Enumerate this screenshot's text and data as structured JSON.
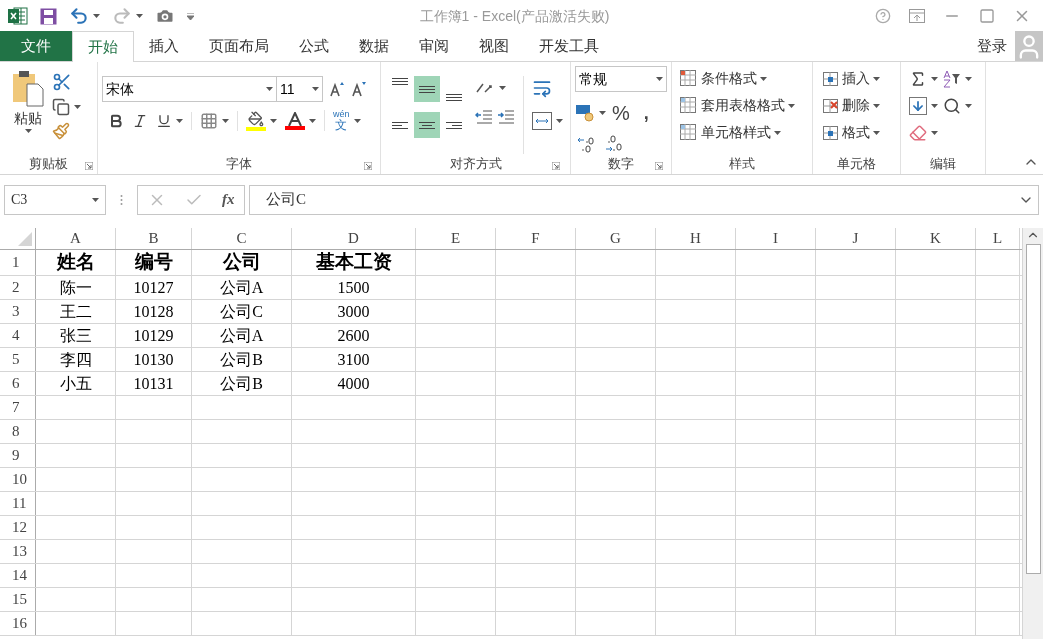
{
  "window": {
    "title": "工作簿1 - Excel(产品激活失败)"
  },
  "tabs": [
    {
      "label": "文件",
      "kind": "file",
      "selected": false
    },
    {
      "label": "开始",
      "kind": "tab",
      "selected": true
    },
    {
      "label": "插入",
      "kind": "tab",
      "selected": false
    },
    {
      "label": "页面布局",
      "kind": "tab",
      "selected": false
    },
    {
      "label": "公式",
      "kind": "tab",
      "selected": false
    },
    {
      "label": "数据",
      "kind": "tab",
      "selected": false
    },
    {
      "label": "审阅",
      "kind": "tab",
      "selected": false
    },
    {
      "label": "视图",
      "kind": "tab",
      "selected": false
    },
    {
      "label": "开发工具",
      "kind": "tab",
      "selected": false
    }
  ],
  "account": {
    "login": "登录"
  },
  "ribbon": {
    "clipboard": {
      "label": "剪贴板",
      "paste": "粘贴"
    },
    "font": {
      "label": "字体",
      "font_name": "宋体",
      "font_size": "11",
      "phonetic": "wén",
      "phonetic_char": "文"
    },
    "alignment": {
      "label": "对齐方式",
      "buttons": [
        {
          "kind": "top",
          "selected": false
        },
        {
          "kind": "middle",
          "selected": true
        },
        {
          "kind": "bottom",
          "selected": false
        },
        {
          "kind": "left",
          "selected": false
        },
        {
          "kind": "center",
          "selected": true
        },
        {
          "kind": "right",
          "selected": false
        }
      ]
    },
    "number": {
      "label": "数字",
      "format": "常规",
      "percent": "%",
      "comma": ","
    },
    "styles": {
      "label": "样式",
      "items": [
        "条件格式",
        "套用表格格式",
        "单元格样式"
      ]
    },
    "cells": {
      "label": "单元格",
      "items": [
        "插入",
        "删除",
        "格式"
      ]
    },
    "editing": {
      "label": "编辑"
    }
  },
  "formula_bar": {
    "name_box": "C3",
    "function_button": "fx",
    "formula": "公司C"
  },
  "sheet": {
    "columns": [
      "A",
      "B",
      "C",
      "D",
      "E",
      "F",
      "G",
      "H",
      "I",
      "J",
      "K",
      "L"
    ],
    "rows": [
      {
        "number": "1",
        "bold": true,
        "cells": [
          "姓名",
          "编号",
          "公司",
          "基本工资"
        ]
      },
      {
        "number": "2",
        "bold": false,
        "cells": [
          "陈一",
          "10127",
          "公司A",
          "1500"
        ]
      },
      {
        "number": "3",
        "bold": false,
        "cells": [
          "王二",
          "10128",
          "公司C",
          "3000"
        ]
      },
      {
        "number": "4",
        "bold": false,
        "cells": [
          "张三",
          "10129",
          "公司A",
          "2600"
        ]
      },
      {
        "number": "5",
        "bold": false,
        "cells": [
          "李四",
          "10130",
          "公司B",
          "3100"
        ]
      },
      {
        "number": "6",
        "bold": false,
        "cells": [
          "小五",
          "10131",
          "公司B",
          "4000"
        ]
      },
      {
        "number": "7",
        "cells": []
      },
      {
        "number": "8",
        "cells": []
      },
      {
        "number": "9",
        "cells": []
      },
      {
        "number": "10",
        "cells": []
      },
      {
        "number": "11",
        "cells": []
      },
      {
        "number": "12",
        "cells": []
      },
      {
        "number": "13",
        "cells": []
      },
      {
        "number": "14",
        "cells": []
      },
      {
        "number": "15",
        "cells": []
      },
      {
        "number": "16",
        "cells": []
      }
    ]
  }
}
